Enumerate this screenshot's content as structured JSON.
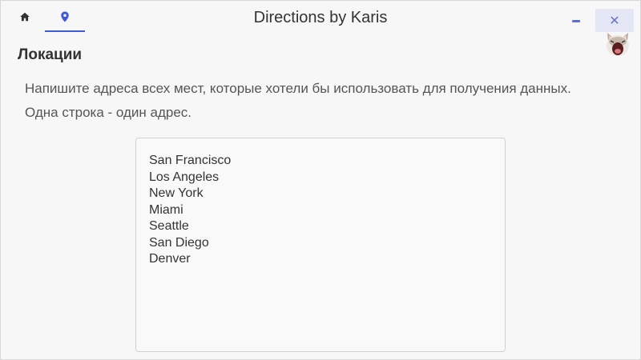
{
  "titlebar": {
    "app_name": "Directions",
    "by_text": "by Karis",
    "tabs": [
      {
        "icon": "home-icon",
        "active": false
      },
      {
        "icon": "location-pin-icon",
        "active": true
      }
    ],
    "minimize_icon": "minimize-icon",
    "close_symbol": "✕",
    "accent_color": "#3d5bd9"
  },
  "section": {
    "title": "Локации",
    "description_line1": "Напишите адреса всех мест, которые хотели бы использовать для получения данных.",
    "description_line2": "Одна строка - один адрес."
  },
  "locations_input": {
    "lines": [
      "San Francisco",
      "Los Angeles",
      "New York",
      "Miami",
      "Seattle",
      "San Diego",
      "Denver"
    ]
  }
}
